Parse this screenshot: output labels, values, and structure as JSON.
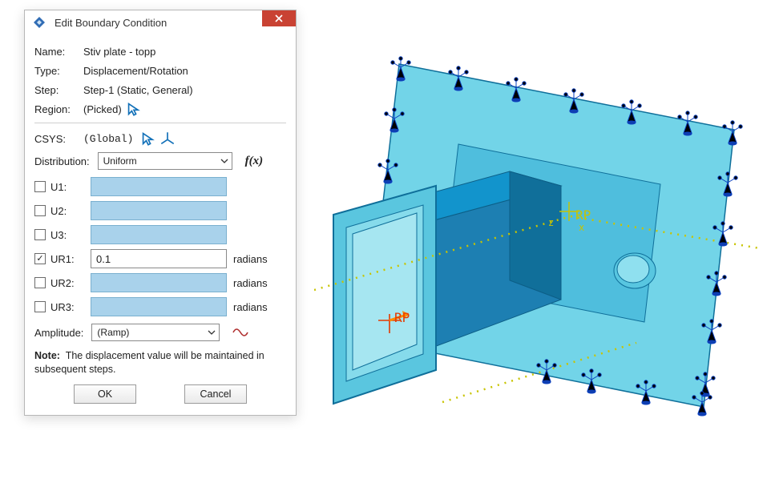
{
  "dialog": {
    "title": "Edit Boundary Condition",
    "fields": {
      "name_label": "Name:",
      "name_value": "Stiv plate - topp",
      "type_label": "Type:",
      "type_value": "Displacement/Rotation",
      "step_label": "Step:",
      "step_value": "Step-1 (Static, General)",
      "region_label": "Region:",
      "region_value": "(Picked)"
    },
    "csys": {
      "label": "CSYS:",
      "value": "(Global)"
    },
    "distribution": {
      "label": "Distribution:",
      "value": "Uniform",
      "fx_label": "f(x)"
    },
    "dofs": [
      {
        "key": "U1",
        "label": "U1:",
        "checked": false,
        "value": "",
        "unit": ""
      },
      {
        "key": "U2",
        "label": "U2:",
        "checked": false,
        "value": "",
        "unit": ""
      },
      {
        "key": "U3",
        "label": "U3:",
        "checked": false,
        "value": "",
        "unit": ""
      },
      {
        "key": "UR1",
        "label": "UR1:",
        "checked": true,
        "value": "0.1",
        "unit": "radians"
      },
      {
        "key": "UR2",
        "label": "UR2:",
        "checked": false,
        "value": "",
        "unit": "radians"
      },
      {
        "key": "UR3",
        "label": "UR3:",
        "checked": false,
        "value": "",
        "unit": "radians"
      }
    ],
    "amplitude": {
      "label": "Amplitude:",
      "value": "(Ramp)"
    },
    "note_label": "Note:",
    "note_text": "The displacement value will be maintained in subsequent steps.",
    "buttons": {
      "ok": "OK",
      "cancel": "Cancel"
    }
  },
  "viewport": {
    "rp_label_1": "RP",
    "rp_label_2": "RP",
    "axis_x": "x",
    "axis_z": "z"
  },
  "icons": {
    "close": "close-icon",
    "pick_arrow": "pick-arrow-icon",
    "csys_axes": "csys-axes-icon",
    "fx": "fx-icon",
    "amplitude_wave": "amplitude-wave-icon",
    "app": "abaqus-app-icon",
    "chevron_down": "chevron-down-icon"
  },
  "colors": {
    "accent_blue": "#1170b8",
    "close_red": "#c94233",
    "wave_red": "#b02f2f",
    "model_light": "#72d4e8",
    "model_dark": "#1d7fb2",
    "model_mid": "#1294cc",
    "bc_orange": "#ff6a00",
    "bc_blue": "#2a5fe0",
    "guide_yellow": "#c8c400"
  }
}
